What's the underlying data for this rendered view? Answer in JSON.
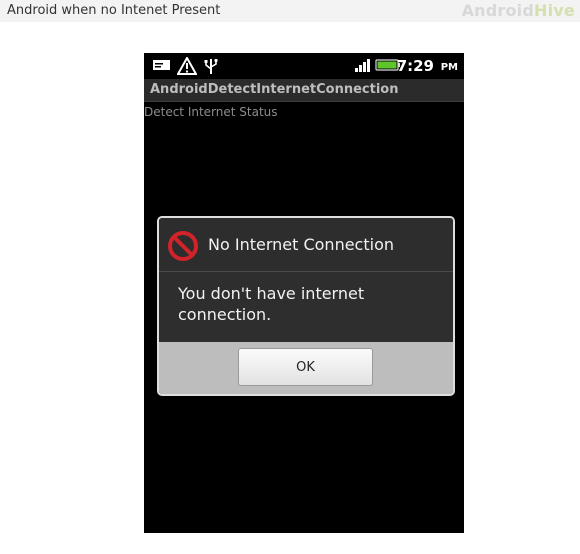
{
  "caption": {
    "text": "Android when no Intenet Present",
    "brand_part1": "Android",
    "brand_part2": "Hive"
  },
  "statusbar": {
    "time": "7:29",
    "ampm": "PM",
    "icons": [
      "message-icon",
      "warning-icon",
      "usb-icon",
      "signal-icon",
      "battery-icon"
    ]
  },
  "app": {
    "title": "AndroidDetectInternetConnection",
    "content_text": "Detect Internet Status"
  },
  "dialog": {
    "icon": "no-entry-icon",
    "title": "No Internet Connection",
    "message": "You don't have internet connection.",
    "ok_label": "OK"
  },
  "colors": {
    "phone_bg": "#000000",
    "dialog_bg": "#2e2e2e",
    "dialog_footer": "#bdbdbd",
    "error_icon": "#d0232a",
    "battery": "#5ec62a"
  }
}
